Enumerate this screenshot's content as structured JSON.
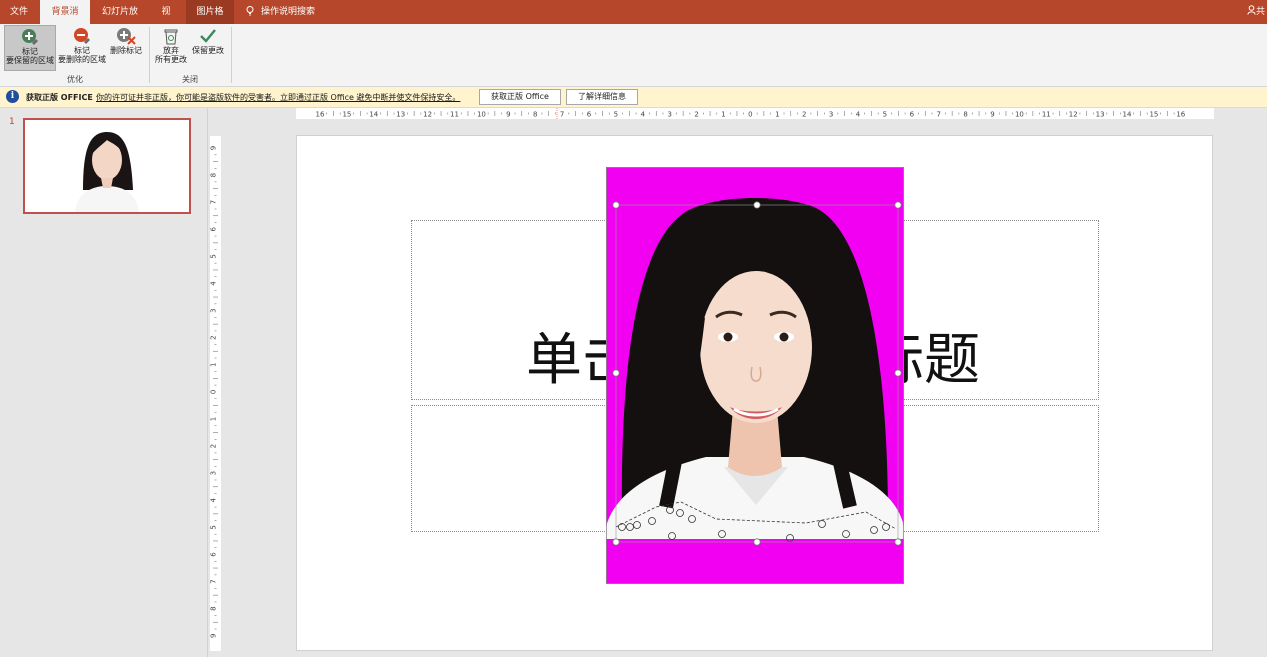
{
  "tabs": {
    "file": "文件",
    "background_removal": "背景消除",
    "slideshow": "幻灯片放映",
    "view": "视图",
    "picture_format": "图片格式",
    "tell_me": "操作说明搜索",
    "share": "共"
  },
  "ribbon": {
    "mark_keep_line1": "标记",
    "mark_keep_line2": "要保留的区域",
    "mark_remove_line1": "标记",
    "mark_remove_line2": "要删除的区域",
    "delete_mark": "删除标记",
    "group_refine": "优化",
    "discard_line1": "放弃",
    "discard_line2": "所有更改",
    "keep_changes": "保留更改",
    "group_close": "关闭"
  },
  "warning": {
    "icon": "i",
    "title": "获取正版 OFFICE",
    "message": "你的许可证并非正版，你可能是盗版软件的受害者。立即通过正版 Office 避免中断并使文件保持安全。",
    "get_genuine": "获取正版 Office",
    "learn_more": "了解详细信息"
  },
  "thumbnails": {
    "slide_number": "1"
  },
  "rulers": {
    "horizontal_labels": [
      "16",
      "15",
      "14",
      "13",
      "12",
      "11",
      "10",
      "9",
      "8",
      "7",
      "6",
      "5",
      "4",
      "3",
      "2",
      "1",
      "0",
      "1",
      "2",
      "3",
      "4",
      "5",
      "6",
      "7",
      "8",
      "9",
      "10",
      "11",
      "12",
      "13",
      "14",
      "15",
      "16"
    ],
    "vertical_labels": [
      "9",
      "8",
      "7",
      "6",
      "5",
      "4",
      "3",
      "2",
      "1",
      "0",
      "1",
      "2",
      "3",
      "4",
      "5",
      "6",
      "7",
      "8",
      "9"
    ]
  },
  "slide": {
    "title_left": "单击",
    "title_right": "标题"
  },
  "colors": {
    "accent": "#b7472a",
    "removal_overlay": "#f200f2",
    "warning_bg": "#fff4ce"
  }
}
